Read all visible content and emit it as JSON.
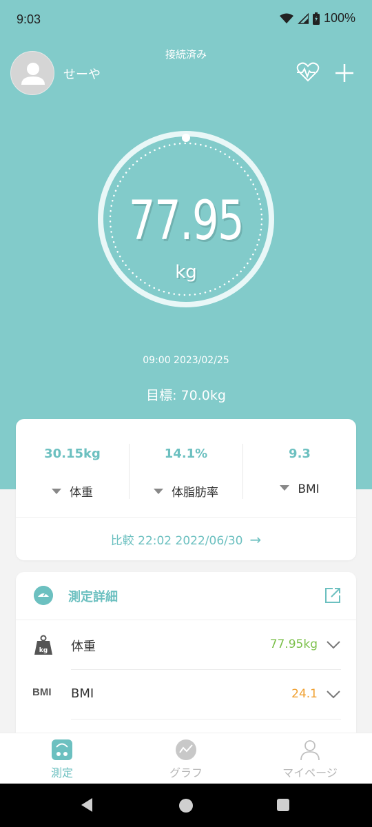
{
  "status_bar": {
    "time": "9:03",
    "battery": "100%"
  },
  "header": {
    "connection_status": "接続済み",
    "username": "せーや"
  },
  "measurement": {
    "weight": "77.95",
    "unit": "kg",
    "datetime": "09:00 2023/02/25",
    "target": "目標: 70.0kg"
  },
  "stats": [
    {
      "value": "30.15kg",
      "label": "体重"
    },
    {
      "value": "14.1%",
      "label": "体脂肪率"
    },
    {
      "value": "9.3",
      "label": "BMI"
    }
  ],
  "compare": {
    "label": "比較 22:02 2022/06/30"
  },
  "details": {
    "title": "測定詳細",
    "rows": [
      {
        "icon": "kg",
        "label": "体重",
        "value": "77.95kg",
        "color": "#7cc04b"
      },
      {
        "icon": "BMI",
        "label": "BMI",
        "value": "24.1",
        "color": "#f0a030"
      }
    ]
  },
  "nav": [
    {
      "label": "測定",
      "active": true
    },
    {
      "label": "グラフ",
      "active": false
    },
    {
      "label": "マイページ",
      "active": false
    }
  ],
  "colors": {
    "teal": "#82cbca",
    "accent": "#6cc0c0",
    "green": "#7cc04b",
    "orange": "#f0a030"
  }
}
